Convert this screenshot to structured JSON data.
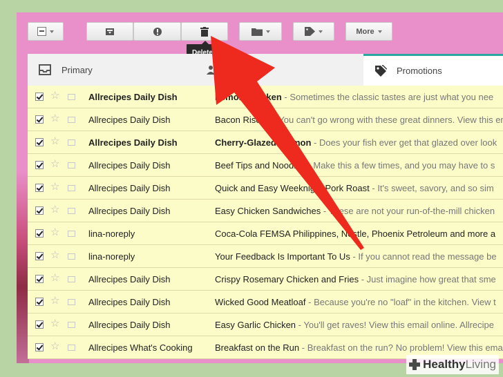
{
  "toolbar": {
    "tooltip": "Delete",
    "more_label": "More"
  },
  "tabs": [
    {
      "label": "Primary",
      "icon": "inbox-icon"
    },
    {
      "label": "",
      "icon": "people-icon"
    },
    {
      "label": "Promotions",
      "icon": "tag-icon"
    }
  ],
  "emails": [
    {
      "sender": "Allrecipes Daily Dish",
      "subject": "Lemon Chicken",
      "snippet": " - Sometimes the classic tastes are just what you nee",
      "unread": true
    },
    {
      "sender": "Allrecipes Daily Dish",
      "subject": "Bacon Risotto",
      "snippet": " - You can't go wrong with these great dinners. View this ema",
      "unread": false
    },
    {
      "sender": "Allrecipes Daily Dish",
      "subject": "Cherry-Glazed Salmon",
      "snippet": " - Does your fish ever get that glazed over look",
      "unread": true
    },
    {
      "sender": "Allrecipes Daily Dish",
      "subject": "Beef Tips and Noodles",
      "snippet": " - Make this a few times, and you may have to s",
      "unread": false
    },
    {
      "sender": "Allrecipes Daily Dish",
      "subject": "Quick and Easy Weeknight Pork Roast",
      "snippet": " - It's sweet, savory, and so sim",
      "unread": false
    },
    {
      "sender": "Allrecipes Daily Dish",
      "subject": "Easy Chicken Sandwiches",
      "snippet": " - These are not your run-of-the-mill chicken",
      "unread": false
    },
    {
      "sender": "lina-noreply",
      "subject": "Coca-Cola FEMSA Philippines, Nestle, Phoenix Petroleum and more a",
      "snippet": "",
      "unread": false
    },
    {
      "sender": "lina-noreply",
      "subject": "Your Feedback Is Important To Us",
      "snippet": " - If you cannot read the message be",
      "unread": false
    },
    {
      "sender": "Allrecipes Daily Dish",
      "subject": "Crispy Rosemary Chicken and Fries",
      "snippet": " - Just imagine how great that sme",
      "unread": false
    },
    {
      "sender": "Allrecipes Daily Dish",
      "subject": "Wicked Good Meatloaf",
      "snippet": " - Because you're no \"loaf\" in the kitchen. View t",
      "unread": false
    },
    {
      "sender": "Allrecipes Daily Dish",
      "subject": "Easy Garlic Chicken",
      "snippet": " - You'll get raves! View this email online. Allrecipe",
      "unread": false
    },
    {
      "sender": "Allrecipes What's Cooking",
      "subject": "Breakfast on the Run",
      "snippet": " - Breakfast on the run? No problem! View this ema",
      "unread": false
    }
  ],
  "brand": {
    "part1": "Healthy",
    "part2": "Living"
  },
  "colors": {
    "arrow": "#ee2a1e",
    "accent": "#2aa8a0",
    "row_bg": "#fcfcc8"
  }
}
